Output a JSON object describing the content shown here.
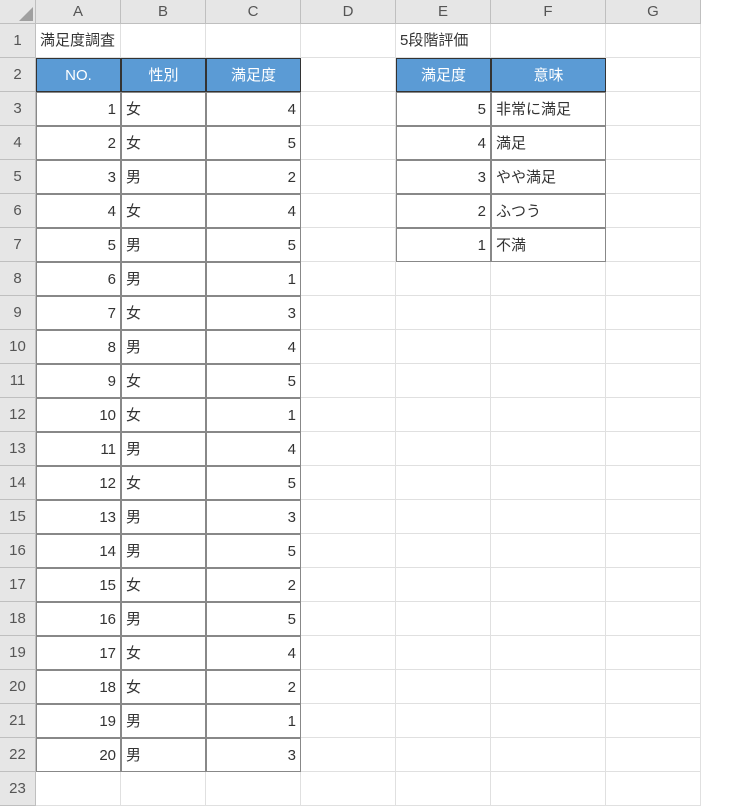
{
  "columns": [
    "A",
    "B",
    "C",
    "D",
    "E",
    "F",
    "G"
  ],
  "row_count": 23,
  "labels": {
    "survey_title": "満足度調査",
    "rating_title": "5段階評価"
  },
  "main_table": {
    "headers": {
      "no": "NO.",
      "gender": "性別",
      "satisfaction": "満足度"
    },
    "rows": [
      {
        "no": 1,
        "gender": "女",
        "satisfaction": 4
      },
      {
        "no": 2,
        "gender": "女",
        "satisfaction": 5
      },
      {
        "no": 3,
        "gender": "男",
        "satisfaction": 2
      },
      {
        "no": 4,
        "gender": "女",
        "satisfaction": 4
      },
      {
        "no": 5,
        "gender": "男",
        "satisfaction": 5
      },
      {
        "no": 6,
        "gender": "男",
        "satisfaction": 1
      },
      {
        "no": 7,
        "gender": "女",
        "satisfaction": 3
      },
      {
        "no": 8,
        "gender": "男",
        "satisfaction": 4
      },
      {
        "no": 9,
        "gender": "女",
        "satisfaction": 5
      },
      {
        "no": 10,
        "gender": "女",
        "satisfaction": 1
      },
      {
        "no": 11,
        "gender": "男",
        "satisfaction": 4
      },
      {
        "no": 12,
        "gender": "女",
        "satisfaction": 5
      },
      {
        "no": 13,
        "gender": "男",
        "satisfaction": 3
      },
      {
        "no": 14,
        "gender": "男",
        "satisfaction": 5
      },
      {
        "no": 15,
        "gender": "女",
        "satisfaction": 2
      },
      {
        "no": 16,
        "gender": "男",
        "satisfaction": 5
      },
      {
        "no": 17,
        "gender": "女",
        "satisfaction": 4
      },
      {
        "no": 18,
        "gender": "女",
        "satisfaction": 2
      },
      {
        "no": 19,
        "gender": "男",
        "satisfaction": 1
      },
      {
        "no": 20,
        "gender": "男",
        "satisfaction": 3
      }
    ]
  },
  "legend_table": {
    "headers": {
      "satisfaction": "満足度",
      "meaning": "意味"
    },
    "rows": [
      {
        "score": 5,
        "meaning": "非常に満足"
      },
      {
        "score": 4,
        "meaning": "満足"
      },
      {
        "score": 3,
        "meaning": "やや満足"
      },
      {
        "score": 2,
        "meaning": "ふつう"
      },
      {
        "score": 1,
        "meaning": "不満"
      }
    ]
  }
}
